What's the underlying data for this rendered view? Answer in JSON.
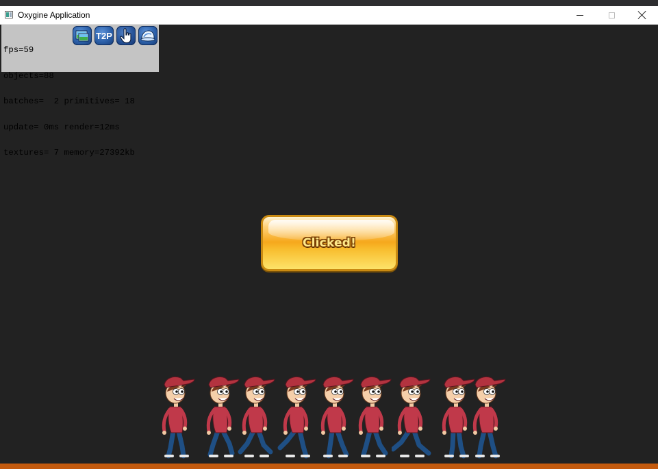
{
  "window": {
    "title": "Oxygine Application",
    "icons": {
      "app": "app-window-icon",
      "minimize": "minimize-icon",
      "maximize": "maximize-icon",
      "close": "close-icon"
    }
  },
  "stats": {
    "lines": [
      "fps=59",
      "objects=88",
      "batches=  2 primitives= 18",
      "update= 0ms render=12ms",
      "textures= 7 memory=27392kb"
    ],
    "tools": [
      {
        "icon": "texture-inspector-icon"
      },
      {
        "icon": "t2p-icon",
        "label": "T2P"
      },
      {
        "icon": "touch-hand-icon"
      },
      {
        "icon": "tree-inspector-icon"
      }
    ]
  },
  "scene": {
    "button_label": "Clicked!",
    "button_colors": {
      "top": "#fff3d2",
      "middle": "#f6a81c",
      "bottom": "#fde36a",
      "border": "#c98a12"
    },
    "characters": 9
  },
  "colors": {
    "background": "#222222",
    "status_bar": "#c35a0e",
    "stats_panel": "#c4c4c4"
  }
}
